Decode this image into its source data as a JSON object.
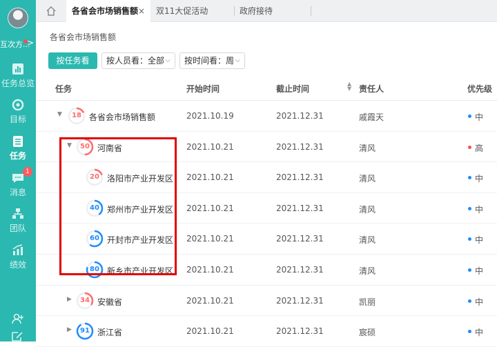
{
  "sidebar": {
    "user_name": "互次方...",
    "user_chevron": ">",
    "items": [
      {
        "label": "任务总览",
        "icon": "overview-icon"
      },
      {
        "label": "目标",
        "icon": "target-icon"
      },
      {
        "label": "任务",
        "icon": "task-icon",
        "active": true
      },
      {
        "label": "消息",
        "icon": "message-icon",
        "badge": "1"
      },
      {
        "label": "团队",
        "icon": "team-icon"
      },
      {
        "label": "绩效",
        "icon": "performance-icon"
      }
    ]
  },
  "tabs": [
    {
      "label": "各省会市场销售额",
      "active": true,
      "close": "×"
    },
    {
      "label": "双11大促活动"
    },
    {
      "label": "政府接待"
    }
  ],
  "breadcrumb": "各省会市场销售额",
  "toolbar": {
    "by_task": "按任务看",
    "by_person": "按人员看：全部",
    "by_time": "按时间看：周",
    "caret": "⌵"
  },
  "table": {
    "headers": {
      "task": "任务",
      "start": "开始时间",
      "end": "截止时间",
      "owner": "责任人",
      "priority": "优先级"
    },
    "rows": [
      {
        "name": "各省会市场销售额",
        "progress": 18,
        "start": "2021.10.19",
        "end": "2021.12.31",
        "owner": "戚霞天",
        "priority": "中",
        "level": 0,
        "toggle": "▼"
      },
      {
        "name": "河南省",
        "progress": 50,
        "start": "2021.10.21",
        "end": "2021.12.31",
        "owner": "清风",
        "priority": "高",
        "level": 1,
        "toggle": "▼"
      },
      {
        "name": "洛阳市产业开发区",
        "progress": 20,
        "start": "2021.10.21",
        "end": "2021.12.31",
        "owner": "清风",
        "priority": "中",
        "level": 2
      },
      {
        "name": "郑州市产业开发区",
        "progress": 40,
        "start": "2021.10.21",
        "end": "2021.12.31",
        "owner": "清风",
        "priority": "中",
        "level": 2
      },
      {
        "name": "开封市产业开发区",
        "progress": 60,
        "start": "2021.10.21",
        "end": "2021.12.31",
        "owner": "清风",
        "priority": "中",
        "level": 2
      },
      {
        "name": "新乡市产业开发区",
        "progress": 80,
        "start": "2021.10.21",
        "end": "2021.12.31",
        "owner": "清风",
        "priority": "中",
        "level": 2
      },
      {
        "name": "安徽省",
        "progress": 34,
        "start": "2021.10.21",
        "end": "2021.12.31",
        "owner": "凯丽",
        "priority": "中",
        "level": 1,
        "toggle": "▶"
      },
      {
        "name": "浙江省",
        "progress": 91,
        "start": "2021.10.21",
        "end": "2021.12.31",
        "owner": "宸硕",
        "priority": "中",
        "level": 1,
        "toggle": "▶"
      }
    ]
  },
  "colors": {
    "brand": "#2bb8b0",
    "low_progress": "#ff6b6b",
    "high_progress": "#1e8bff",
    "priority_high": "#ff4d4f",
    "priority_mid": "#1e8bff"
  }
}
